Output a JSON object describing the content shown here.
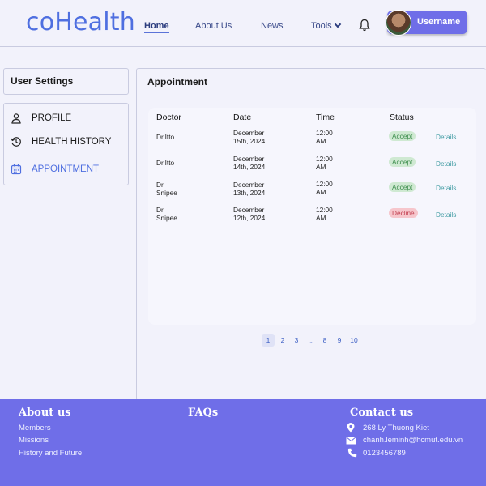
{
  "header": {
    "logo": "coHealth",
    "nav": [
      "Home",
      "About Us",
      "News",
      "Tools"
    ],
    "username": "Username"
  },
  "sidebar": {
    "title": "User Settings",
    "items": [
      {
        "label": "PROFILE",
        "icon": "user-icon"
      },
      {
        "label": "HEALTH HISTORY",
        "icon": "history-icon"
      },
      {
        "label": "APPOINTMENT",
        "icon": "calendar-icon",
        "active": true
      }
    ]
  },
  "main": {
    "title": "Appointment",
    "columns": [
      "Doctor",
      "Date",
      "Time",
      "Status"
    ],
    "rows": [
      {
        "doctor": [
          "Dr.Itto"
        ],
        "date": [
          "December",
          "15th, 2024"
        ],
        "time": [
          "12:00",
          "AM"
        ],
        "status": "Accept",
        "details": "Details"
      },
      {
        "doctor": [
          "Dr.Itto"
        ],
        "date": [
          "December",
          "14th, 2024"
        ],
        "time": [
          "12:00",
          "AM"
        ],
        "status": "Accept",
        "details": "Details"
      },
      {
        "doctor": [
          "Dr.",
          "Snipee"
        ],
        "date": [
          "December",
          "13th, 2024"
        ],
        "time": [
          "12:00",
          "AM"
        ],
        "status": "Accept",
        "details": "Details"
      },
      {
        "doctor": [
          "Dr.",
          "Snipee"
        ],
        "date": [
          "December",
          "12th, 2024"
        ],
        "time": [
          "12:00",
          "AM"
        ],
        "status": "Decline",
        "details": "Details"
      }
    ],
    "pagination": [
      "1",
      "2",
      "3",
      "...",
      "8",
      "9",
      "10"
    ],
    "current_page": "1"
  },
  "footer": {
    "about": {
      "title": "About us",
      "links": [
        "Members",
        "Missions",
        "History and Future"
      ]
    },
    "faqs": {
      "title": "FAQs"
    },
    "contact": {
      "title": "Contact us",
      "address": "268 Ly Thuong Kiet",
      "email": "chanh.leminh@hcmut.edu.vn",
      "phone": "0123456789"
    }
  },
  "colors": {
    "brand": "#4f6fe0",
    "footer_bg": "#6f6ee8",
    "accept_bg": "#cfe9d2",
    "decline_bg": "#f6c6cc"
  }
}
